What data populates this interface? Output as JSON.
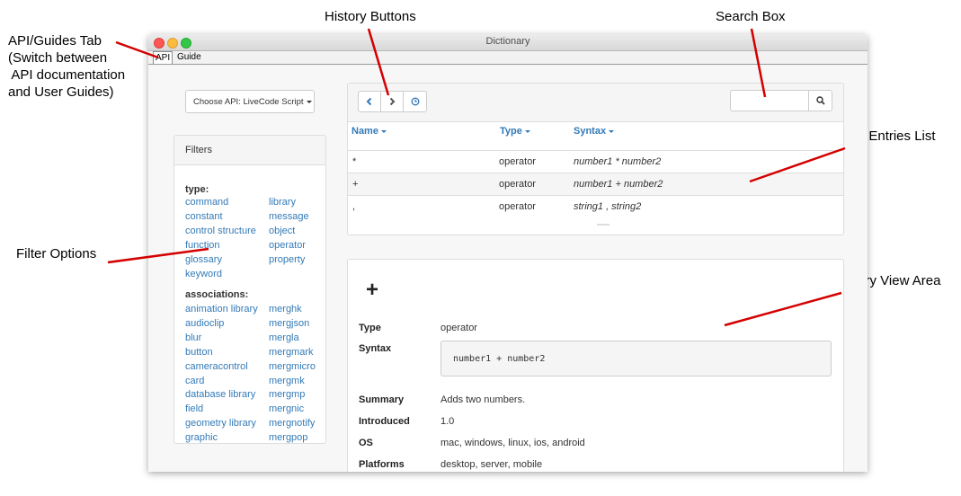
{
  "annotations": {
    "api_guides_tab": [
      "API/Guides Tab",
      "(Switch between",
      " API documentation",
      "and User Guides)"
    ],
    "history_buttons": "History Buttons",
    "search_box": "Search Box",
    "api_entries_list": "API Entries List",
    "filter_options": "Filter Options",
    "entry_view_area": "Entry View Area",
    "color": "#d40000"
  },
  "window": {
    "title": "Dictionary",
    "tabs": [
      "API",
      "Guide"
    ]
  },
  "api_chooser": {
    "label": "Choose API: LiveCode Script"
  },
  "filters": {
    "title": "Filters",
    "type_heading": "type:",
    "type_col1": [
      "command",
      "constant",
      "control structure",
      "function",
      "glossary",
      "keyword"
    ],
    "type_col2": [
      "library",
      "message",
      "object",
      "operator",
      "property"
    ],
    "assoc_heading": "associations:",
    "assoc_col1": [
      "animation library",
      "audioclip",
      "blur",
      "button",
      "cameracontrol",
      "card",
      "database library",
      "field",
      "geometry library",
      "graphic"
    ],
    "assoc_col2": [
      "merghk",
      "mergjson",
      "mergla",
      "mergmark",
      "mergmicro",
      "mergmk",
      "mergmp",
      "mergnic",
      "mergnotify",
      "mergpop"
    ]
  },
  "history": {
    "icons": [
      "chevron-left-icon",
      "chevron-right-icon",
      "clock-icon"
    ]
  },
  "search": {
    "placeholder": "",
    "icon": "search-icon"
  },
  "table": {
    "columns": [
      "Name",
      "Type",
      "Syntax"
    ],
    "rows": [
      {
        "name": "*",
        "type": "operator",
        "syntax": "number1 * number2"
      },
      {
        "name": "+",
        "type": "operator",
        "syntax": "number1 + number2"
      },
      {
        "name": ",",
        "type": "operator",
        "syntax": "string1 , string2"
      }
    ]
  },
  "entry": {
    "title": "+",
    "type_label": "Type",
    "type_value": "operator",
    "syntax_label": "Syntax",
    "syntax_value": "number1 + number2",
    "summary_label": "Summary",
    "summary_value": "Adds two numbers.",
    "introduced_label": "Introduced",
    "introduced_value": "1.0",
    "os_label": "OS",
    "os_value": "mac, windows, linux, ios, android",
    "platforms_label": "Platforms",
    "platforms_value": "desktop, server, mobile"
  }
}
